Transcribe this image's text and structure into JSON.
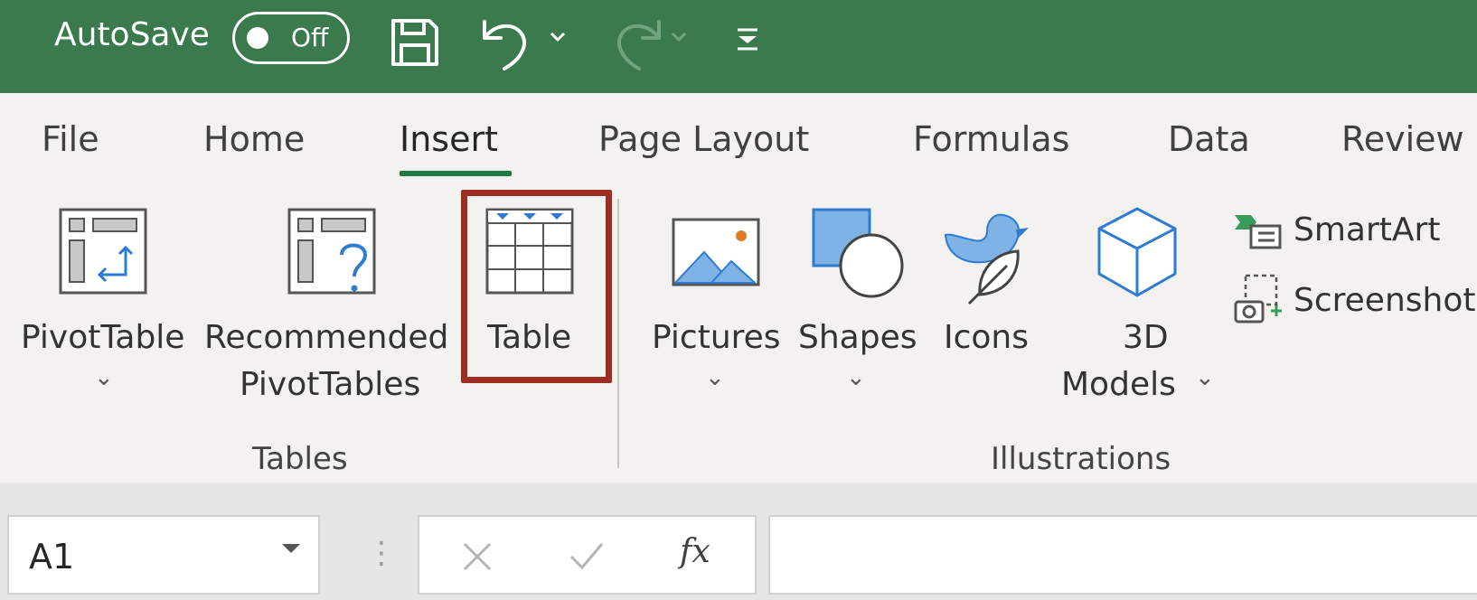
{
  "titlebar": {
    "autosave_label": "AutoSave",
    "autosave_state": "Off",
    "icons": [
      "save-icon",
      "undo-icon",
      "redo-icon",
      "customize-qat-icon"
    ],
    "background_color": "#3a7a4d"
  },
  "tabs": [
    {
      "label": "File"
    },
    {
      "label": "Home"
    },
    {
      "label": "Insert",
      "active": true
    },
    {
      "label": "Page Layout"
    },
    {
      "label": "Formulas"
    },
    {
      "label": "Data"
    },
    {
      "label": "Review"
    }
  ],
  "ribbon": {
    "tables_group": {
      "label": "Tables",
      "pivottable": {
        "label": "PivotTable"
      },
      "recommended": {
        "label_line1": "Recommended",
        "label_line2": "PivotTables"
      },
      "table": {
        "label": "Table",
        "highlighted": true
      }
    },
    "illustrations_group": {
      "label": "Illustrations",
      "pictures": {
        "label": "Pictures"
      },
      "shapes": {
        "label": "Shapes"
      },
      "icons": {
        "label": "Icons"
      },
      "models3d": {
        "label_line1": "3D",
        "label_line2": "Models"
      },
      "smartart": {
        "label": "SmartArt"
      },
      "screenshot": {
        "label": "Screenshot"
      }
    }
  },
  "formula_bar": {
    "name_box_value": "A1",
    "fx_label": "fx",
    "formula_value": ""
  },
  "colors": {
    "accent_green": "#1f7a45",
    "highlight_red": "#9e2c21",
    "icon_blue": "#2e7bcf"
  }
}
